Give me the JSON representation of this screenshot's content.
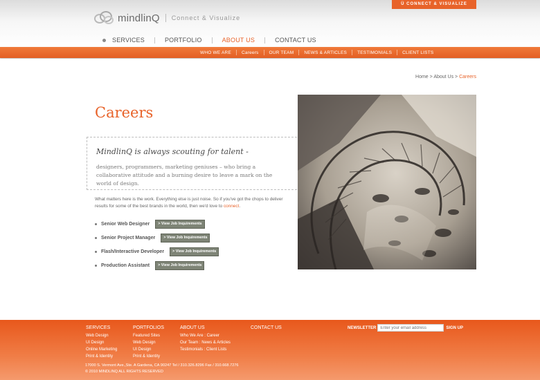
{
  "header": {
    "top_tag": "Ü CONNECT & VISUALIZE",
    "logo_name": "mindlinQ",
    "logo_tagline": "Connect & Visualize"
  },
  "mainnav": {
    "items": [
      {
        "label": "SERVICES"
      },
      {
        "label": "PORTFOLIO"
      },
      {
        "label": "ABOUT US"
      },
      {
        "label": "CONTACT US"
      }
    ],
    "active": "ABOUT US"
  },
  "subnav": {
    "items": [
      "WHO WE ARE",
      "Careers",
      "OUR TEAM",
      "NEWS & ARTICLES",
      "TESTIMONIALS",
      "CLIENT LISTS"
    ]
  },
  "breadcrumb": {
    "home": "Home",
    "sep1": " > ",
    "about": "About Us",
    "sep2": " > ",
    "current": "Careers"
  },
  "page": {
    "title": "Careers",
    "intro_heading": "MindlinQ is always scouting for talent -",
    "intro_text": "designers, programmers, marketing geniuses – who bring a collaborative attitude and a burning desire to leave a mark on the world of design.",
    "body_text": "What matters here is the work. Everything else is just noise. So if you've got the chops to deliver results for some of the best brands in the world, then we'd love to ",
    "body_link": "connect",
    "body_end": "."
  },
  "jobs": [
    {
      "title": "Senior Web Designer",
      "button": "> View Job Inquirements"
    },
    {
      "title": "Senior Project Manager",
      "button": "> View Job Inquirements"
    },
    {
      "title": "Flash/Interactive Developer",
      "button": "> View Job Inquirements"
    },
    {
      "title": "Production Assistant",
      "button": "> View Job Inquirements"
    }
  ],
  "footer": {
    "services": {
      "heading": "SERVICES",
      "links": [
        "Web Design",
        "UI Design",
        "Online Marketing",
        "Print & Identity"
      ]
    },
    "portfolios": {
      "heading": "PORTFOLIOS",
      "links": [
        "Featured Sites",
        "Web Design",
        "UI Design",
        "Print & Identity"
      ]
    },
    "about": {
      "heading": "ABOUT US",
      "links": [
        "Who We Are : Career",
        "Our Team : News & Articles",
        "Testimonials : Client Lists"
      ]
    },
    "contact": {
      "heading": "CONTACT US"
    },
    "newsletter": {
      "label": "NEWSLETTER",
      "placeholder": "Enter your email address",
      "button": "SIGN UP"
    },
    "address": "17000 S. Vermont Ave.,Ste. A Gardena, CA 90247 Tel / 310.326.8296 Fax / 310.668.7276",
    "copyright": "© 2010 MINDLINQ ALL RIGHTS RESERVED"
  },
  "colors": {
    "accent": "#e8632a",
    "button": "#7e8476"
  }
}
